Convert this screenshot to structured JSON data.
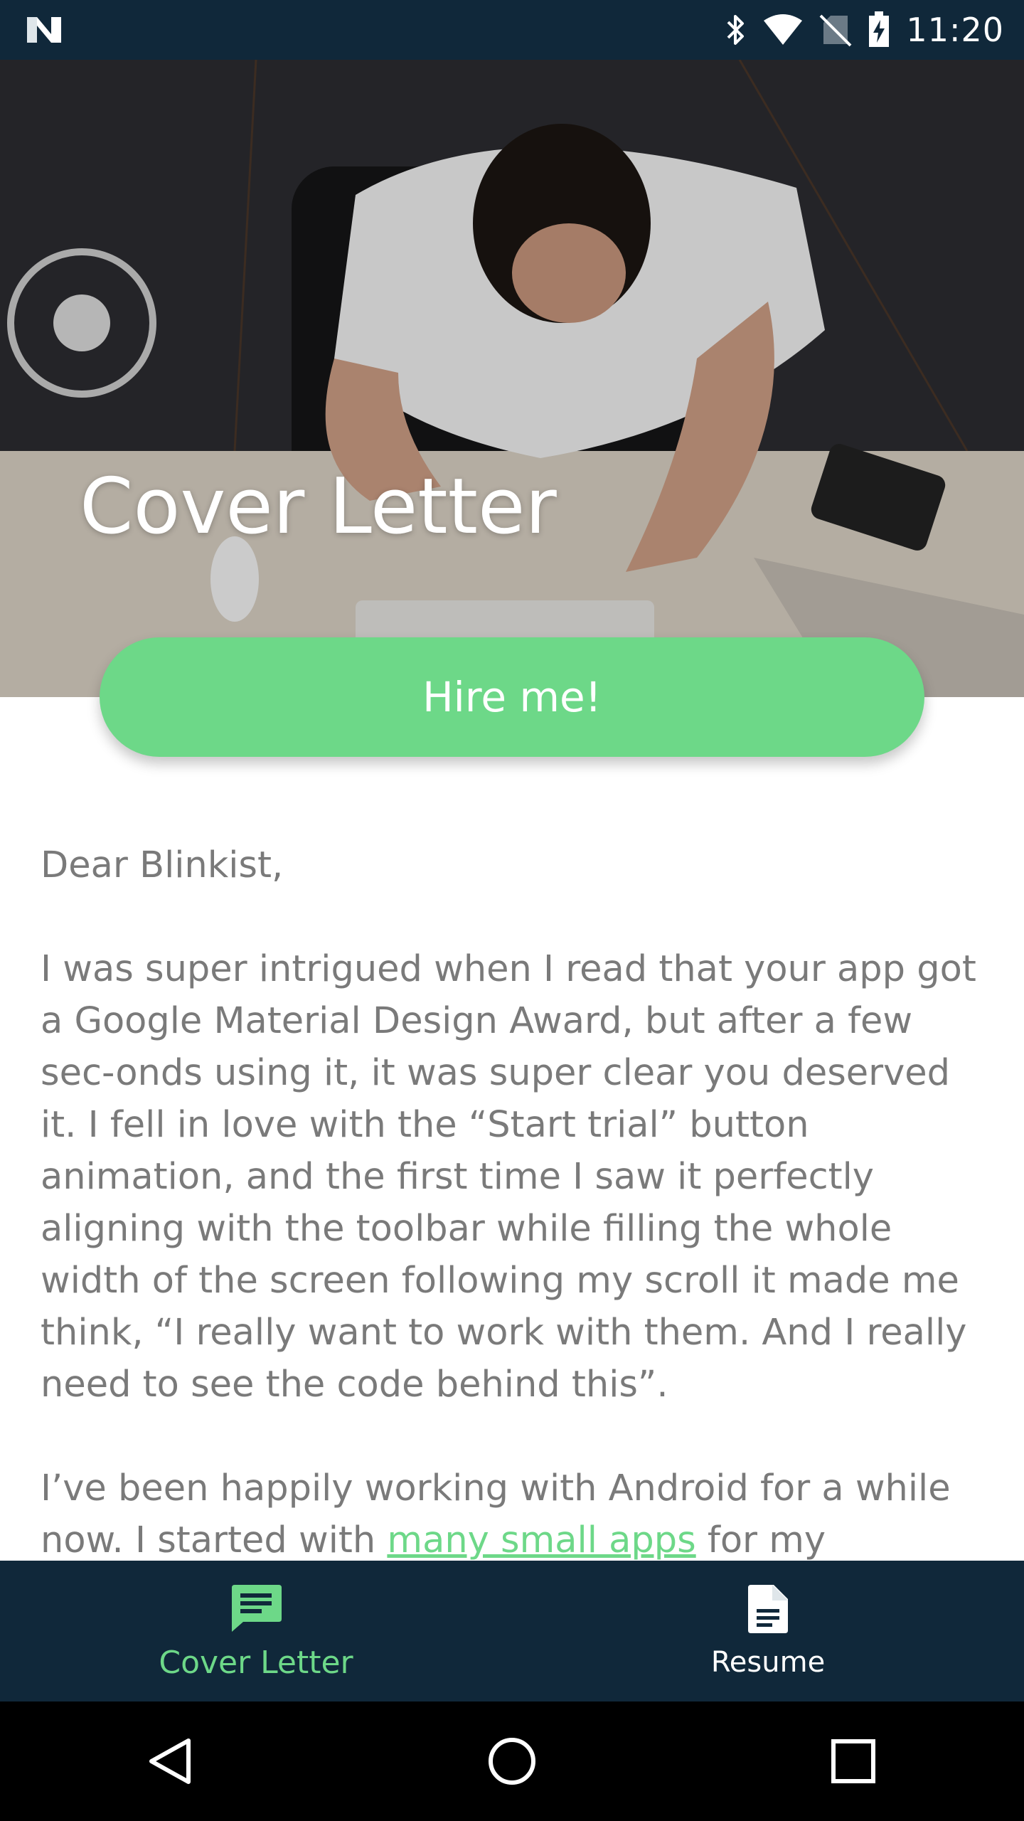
{
  "status_bar": {
    "time": "11:20",
    "icons": [
      "n-logo-icon",
      "bluetooth-icon",
      "wifi-icon",
      "no-sim-icon",
      "battery-charging-icon"
    ]
  },
  "hero": {
    "title": "Cover Letter",
    "image": "person-at-desk-photo"
  },
  "cta": {
    "label": "Hire me!"
  },
  "letter": {
    "salutation": "Dear Blinkist,",
    "paragraph_1": "I was super intrigued when I read that your app got a Google Material Design Award, but after a few sec-onds using it, it was super clear you deserved it. I fell in love with the “Start trial” button animation, and the first time I saw it perfectly aligning with the toolbar while filling the whole width of the screen following my scroll it made me think, “I really want to work with them. And I really need to see the code behind this”.",
    "paragraph_2_before_link": "I’ve been happily working with Android for a while now. I started with ",
    "paragraph_2_link": "many small apps",
    "paragraph_2_after_link": " for my university and local businesses. Then I joined ArcTouch and"
  },
  "bottom_nav": {
    "items": [
      {
        "label": "Cover Letter",
        "icon": "message-icon",
        "active": true
      },
      {
        "label": "Resume",
        "icon": "document-icon",
        "active": false
      }
    ]
  },
  "system_nav": {
    "icons": [
      "back-icon",
      "home-icon",
      "recents-icon"
    ]
  },
  "colors": {
    "accent": "#6dd888",
    "bar": "#10283a",
    "body_text": "#7a7a7a"
  }
}
